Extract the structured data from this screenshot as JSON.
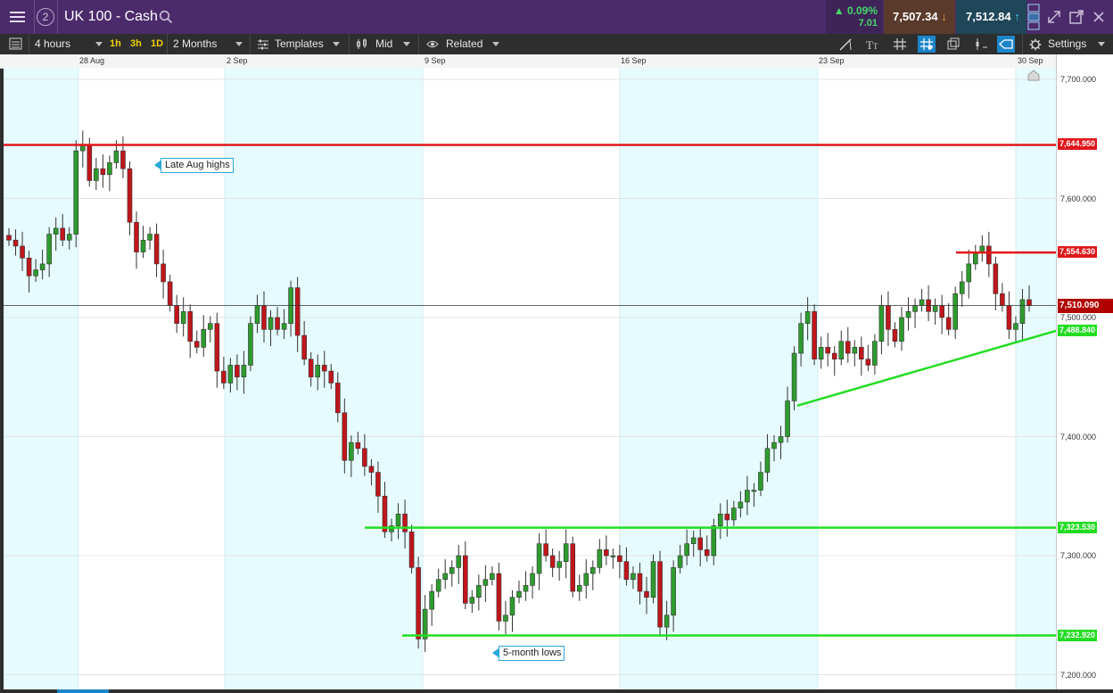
{
  "header": {
    "window_count": "2",
    "title": "UK 100 - Cash",
    "change_pct": "0.09%",
    "change_abs": "7.01",
    "sell_price": "7,507.34",
    "buy_price": "7,512.84"
  },
  "toolbar": {
    "interval": "4 hours",
    "timeframes": [
      "1h",
      "3h",
      "1D"
    ],
    "range": "2 Months",
    "templates": "Templates",
    "price_mode": "Mid",
    "related": "Related",
    "settings": "Settings"
  },
  "date_axis": [
    "28 Aug",
    "2 Sep",
    "9 Sep",
    "16 Sep",
    "23 Sep",
    "30 Sep"
  ],
  "price_axis": [
    "7,700.000",
    "7,600.000",
    "7,500.000",
    "7,400.000",
    "7,300.000",
    "7,200.000"
  ],
  "price_tags": {
    "resistance_high": "7,644.950",
    "resistance_recent": "7,554.630",
    "current": "7,510.090",
    "trendline": "7,488.840",
    "support_mid": "7,323.530",
    "support_low": "7,232.920"
  },
  "annotations": {
    "highs": "Late Aug highs",
    "lows": "5-month lows"
  },
  "colors": {
    "header_bg": "#4b2b6b",
    "up_candle": "#2e9b2e",
    "down_candle": "#c0161c",
    "resistance": "#e0181c",
    "support": "#22dd22",
    "weekend_shade": "#e6fbfd"
  },
  "chart_data": {
    "type": "candlestick",
    "instrument": "UK 100 - Cash",
    "interval": "4 hours",
    "x_labels": [
      "28 Aug",
      "2 Sep",
      "9 Sep",
      "16 Sep",
      "23 Sep",
      "30 Sep"
    ],
    "ylim": [
      7190,
      7710
    ],
    "y_ticks": [
      7200,
      7300,
      7400,
      7500,
      7600,
      7700
    ],
    "last_price": 7510.09,
    "candle_closes_approx": [
      7565,
      7560,
      7550,
      7535,
      7540,
      7545,
      7570,
      7575,
      7565,
      7570,
      7640,
      7645,
      7615,
      7625,
      7620,
      7630,
      7640,
      7625,
      7580,
      7555,
      7565,
      7570,
      7545,
      7530,
      7510,
      7495,
      7505,
      7480,
      7475,
      7490,
      7495,
      7455,
      7445,
      7460,
      7450,
      7460,
      7495,
      7510,
      7490,
      7500,
      7490,
      7495,
      7525,
      7485,
      7465,
      7450,
      7460,
      7455,
      7445,
      7420,
      7380,
      7395,
      7390,
      7375,
      7370,
      7350,
      7320,
      7325,
      7335,
      7320,
      7290,
      7230,
      7255,
      7270,
      7280,
      7285,
      7290,
      7300,
      7260,
      7265,
      7275,
      7280,
      7285,
      7245,
      7250,
      7265,
      7270,
      7275,
      7285,
      7310,
      7300,
      7290,
      7295,
      7310,
      7270,
      7275,
      7285,
      7290,
      7305,
      7300,
      7300,
      7295,
      7280,
      7285,
      7270,
      7265,
      7295,
      7240,
      7250,
      7290,
      7300,
      7310,
      7315,
      7305,
      7300,
      7325,
      7335,
      7330,
      7340,
      7345,
      7355,
      7355,
      7370,
      7390,
      7395,
      7400,
      7430,
      7470,
      7495,
      7505,
      7465,
      7475,
      7470,
      7465,
      7480,
      7470,
      7475,
      7465,
      7460,
      7480,
      7510,
      7490,
      7480,
      7500,
      7505,
      7510,
      7515,
      7505,
      7510,
      7500,
      7490,
      7520,
      7530,
      7545,
      7555,
      7560,
      7545,
      7520,
      7510,
      7490,
      7495,
      7515,
      7510
    ],
    "horizontal_levels": [
      7644.95,
      7554.63,
      7323.53,
      7232.92
    ],
    "trendline_level": 7488.84
  }
}
